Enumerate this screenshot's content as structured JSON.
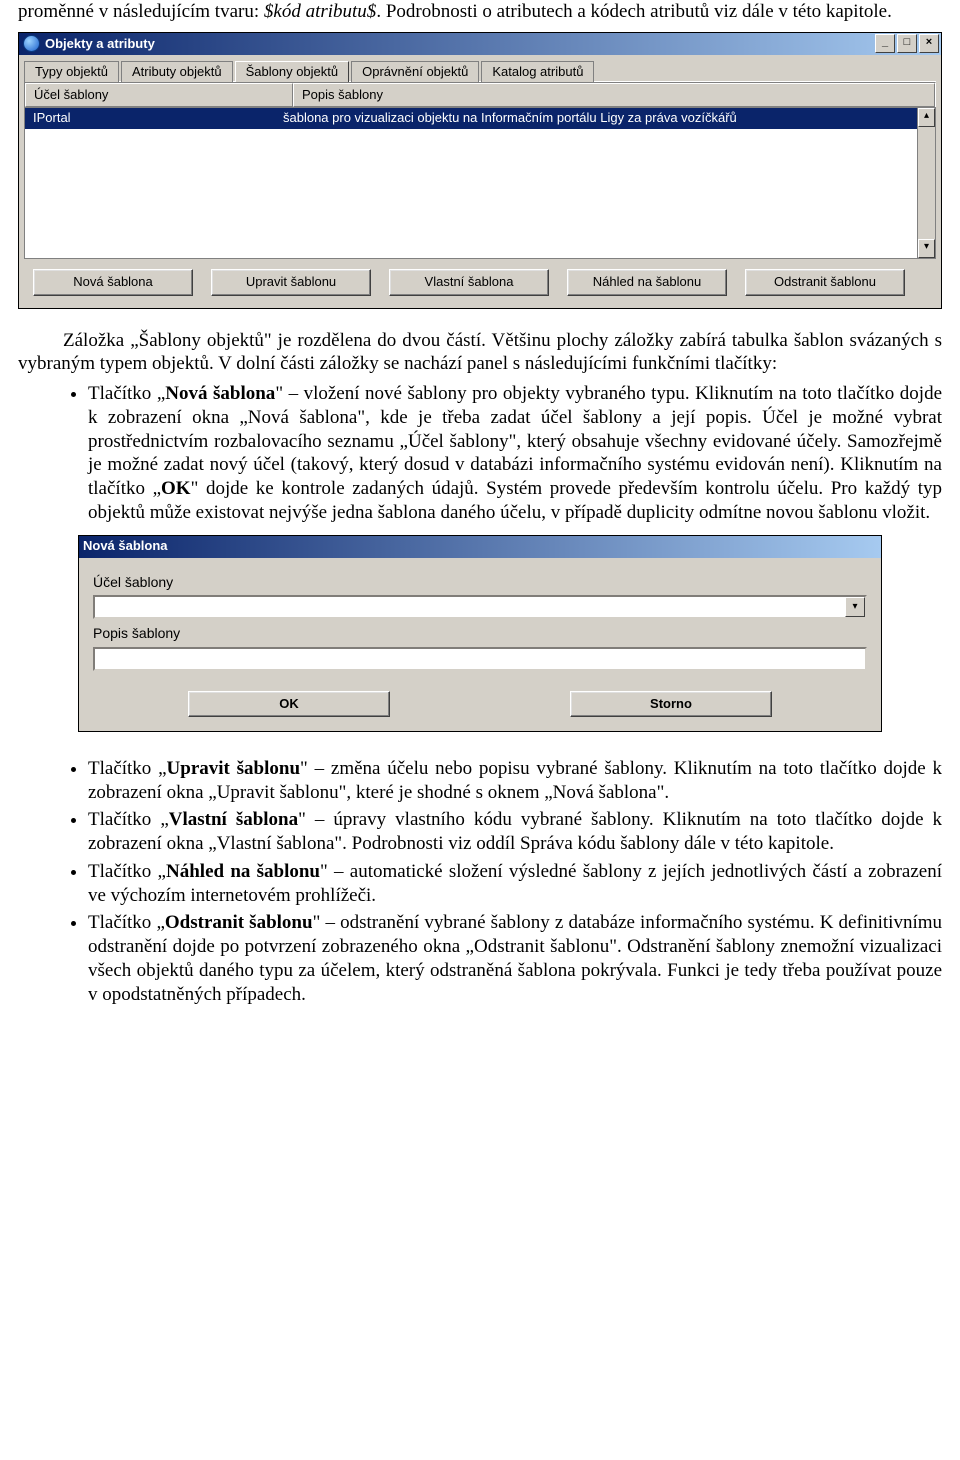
{
  "para_intro": "proměnné v následujícím tvaru: ",
  "para_intro_italic": "$kód atributu$",
  "para_intro2": ". Podrobnosti o atributech a kódech atributů viz dále v této kapitole.",
  "win1": {
    "title": "Objekty a atributy",
    "tabs": [
      "Typy objektů",
      "Atributy objektů",
      "Šablony objektů",
      "Oprávnění objektů",
      "Katalog atributů"
    ],
    "active_tab": 2,
    "col1": "Účel šablony",
    "col2": "Popis šablony",
    "row_col1": "IPortal",
    "row_col2": "šablona pro vizualizaci objektu na Informačním portálu Ligy za práva vozíčkářů",
    "buttons": [
      "Nová šablona",
      "Upravit šablonu",
      "Vlastní šablona",
      "Náhled na šablonu",
      "Odstranit šablonu"
    ],
    "minimize": "_",
    "maximize": "□",
    "close": "×",
    "scroll_up": "▴",
    "scroll_down": "▾"
  },
  "para2_a": "Záložka „Šablony objektů\" je rozdělena do dvou částí. Většinu plochy záložky zabírá tabulka šablon svázaných s vybraným typem objektů. V dolní části záložky se nachází panel s následujícími funkčními tlačítky:",
  "bullet1_a": "Tlačítko „",
  "bullet1_b": "Nová šablona",
  "bullet1_c": "\" – vložení nové šablony pro objekty vybraného typu. Kliknutím na toto tlačítko dojde k zobrazení okna „Nová šablona\", kde je třeba zadat účel šablony a její popis. Účel je možné vybrat prostřednictvím rozbalovacího seznamu „Účel šablony\", který obsahuje všechny evidované účely. Samozřejmě je možné zadat nový účel (takový, který dosud v databázi informačního systému evidován není). Kliknutím na tlačítko „",
  "bullet1_d": "OK",
  "bullet1_e": "\" dojde ke kontrole zadaných údajů. Systém provede především kontrolu účelu. Pro každý typ objektů může existovat nejvýše jedna šablona daného účelu, v případě duplicity odmítne novou šablonu vložit.",
  "dlg": {
    "title": "Nová šablona",
    "lbl1": "Účel šablony",
    "lbl2": "Popis šablony",
    "ok": "OK",
    "cancel": "Storno",
    "combo_arrow": "▾"
  },
  "bullets_after": [
    {
      "a": "Tlačítko „",
      "b": "Upravit šablonu",
      "c": "\" – změna účelu nebo popisu vybrané šablony. Kliknutím na toto tlačítko dojde k zobrazení okna „Upravit šablonu\", které je shodné s oknem „Nová šablona\"."
    },
    {
      "a": "Tlačítko „",
      "b": "Vlastní šablona",
      "c": "\" – úpravy vlastního kódu vybrané šablony. Kliknutím na toto tlačítko dojde k zobrazení okna „Vlastní šablona\". Podrobnosti viz oddíl Správa kódu šablony dále v této kapitole."
    },
    {
      "a": "Tlačítko „",
      "b": "Náhled na šablonu",
      "c": "\" – automatické složení výsledné šablony z jejích jednotlivých částí a zobrazení  ve výchozím internetovém prohlížeči."
    },
    {
      "a": "Tlačítko „",
      "b": "Odstranit šablonu",
      "c": "\" – odstranění vybrané šablony z databáze informačního systému. K definitivnímu odstranění dojde po potvrzení zobrazeného okna „Odstranit šablonu\". Odstranění šablony znemožní vizualizaci všech objektů daného typu za účelem, který odstraněná šablona pokrývala. Funkci je tedy třeba používat pouze v opodstatněných případech."
    }
  ]
}
